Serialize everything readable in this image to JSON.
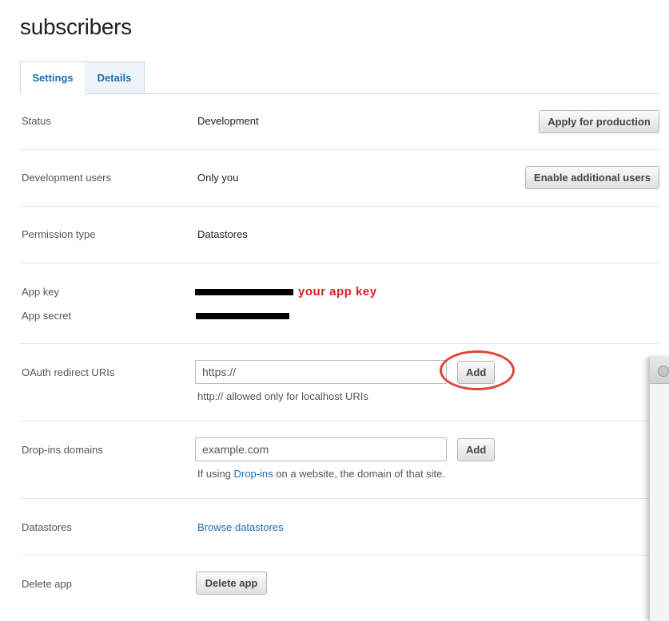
{
  "page_title": "subscribers",
  "tabs": [
    {
      "label": "Settings",
      "active": true
    },
    {
      "label": "Details",
      "active": false
    }
  ],
  "rows": {
    "status": {
      "label": "Status",
      "value": "Development",
      "button": "Apply for production"
    },
    "dev_users": {
      "label": "Development users",
      "value": "Only you",
      "button": "Enable additional users"
    },
    "permission": {
      "label": "Permission type",
      "value": "Datastores"
    },
    "app_key": {
      "label": "App key",
      "annotation": "your app key"
    },
    "app_secret": {
      "label": "App secret"
    },
    "oauth": {
      "label": "OAuth redirect URIs",
      "placeholder": "https://",
      "button": "Add",
      "hint": "http:// allowed only for localhost URIs"
    },
    "dropins": {
      "label": "Drop-ins domains",
      "placeholder": "example.com",
      "button": "Add",
      "hint_prefix": "If using ",
      "hint_link": "Drop-ins",
      "hint_suffix": " on a website, the domain of that site."
    },
    "datastores": {
      "label": "Datastores",
      "link": "Browse datastores"
    },
    "delete": {
      "label": "Delete app",
      "button": "Delete app"
    }
  },
  "colors": {
    "accent_link": "#1a6fb5",
    "annotation_red": "#e01e1e",
    "circle_red": "#e0443a"
  }
}
